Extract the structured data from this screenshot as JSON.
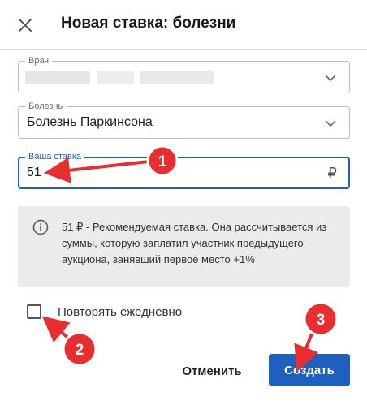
{
  "dialog": {
    "title": "Новая ставка: болезни",
    "close_icon": "close-icon"
  },
  "fields": {
    "doctor": {
      "label": "Врач",
      "value": ""
    },
    "disease": {
      "label": "Болезнь",
      "value": "Болезнь Паркинсона"
    },
    "bid": {
      "label": "Ваша ставка",
      "value": "51",
      "currency": "₽"
    }
  },
  "info": {
    "text": "51 ₽ - Рекомендуемая ставка. Она рассчитывается из суммы, которую заплатил участник предыдущего аукциона, занявший первое место +1%"
  },
  "repeat": {
    "label": "Повторять ежедневно",
    "checked": false
  },
  "buttons": {
    "cancel": "Отменить",
    "create": "Создать"
  },
  "annotations": [
    {
      "number": "1",
      "color": "#e82e2e"
    },
    {
      "number": "2",
      "color": "#e82e2e"
    },
    {
      "number": "3",
      "color": "#e82e2e"
    }
  ],
  "colors": {
    "accent": "#1f5fbf",
    "annotation": "#e82e2e",
    "info_bg": "#ebebeb"
  }
}
